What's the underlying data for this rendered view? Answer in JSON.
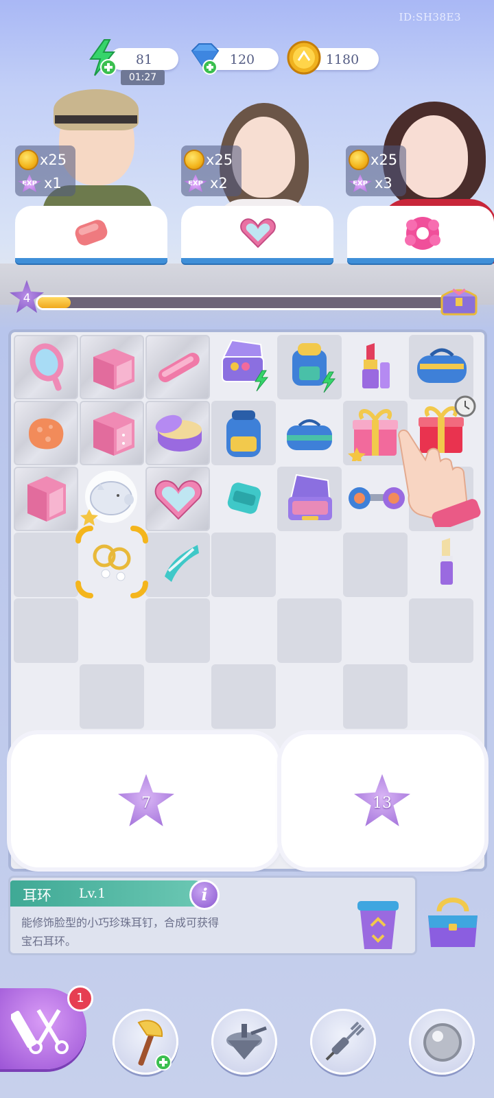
{
  "header": {
    "player_id": "ID:SH38E3",
    "energy": {
      "icon": "lightning-icon",
      "value": "81",
      "timer": "01:27"
    },
    "gems": {
      "icon": "diamond-icon",
      "value": "120"
    },
    "coins": {
      "icon": "coin-icon",
      "value": "1180"
    }
  },
  "orders": [
    {
      "coin_reward": "x25",
      "exp_reward": "x1",
      "exp_label": "EXP",
      "item_icon": "soap-icon"
    },
    {
      "coin_reward": "x25",
      "exp_reward": "x2",
      "exp_label": "EXP",
      "item_icon": "heart-compact-icon"
    },
    {
      "coin_reward": "x25",
      "exp_reward": "x3",
      "exp_label": "EXP",
      "item_icon": "scrunchie-icon"
    }
  ],
  "level": {
    "value": "4",
    "progress": 0.08
  },
  "locked_zones": [
    {
      "required_level": "7"
    },
    {
      "required_level": "13"
    }
  ],
  "selected_item": {
    "name": "耳环",
    "level": "Lv.1",
    "description": "能修饰脸型的小巧珍珠耳钉，合成可获得宝石耳环。"
  },
  "tools": [
    {
      "icon": "axe-icon"
    },
    {
      "icon": "spinning-top-icon"
    },
    {
      "icon": "dart-icon"
    },
    {
      "icon": "pearl-icon"
    }
  ],
  "main_action": {
    "badge_count": "1",
    "icon": "comb-scissors-icon"
  },
  "colors": {
    "accent": "#3f8fd8",
    "teal": "#3fa995",
    "purple": "#9c55d6",
    "badge": "#e63e52"
  }
}
